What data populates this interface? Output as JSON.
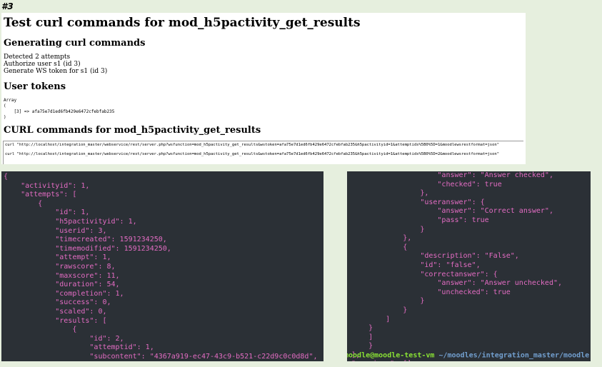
{
  "label": "#3",
  "page": {
    "title": "Test curl commands for mod_h5pactivity_get_results",
    "heading_generating": "Generating curl commands",
    "status_lines": [
      "Detected 2 attempts",
      "Authorize user s1 (id 3)",
      "Generate WS token for s1 (id 3)"
    ],
    "heading_tokens": "User tokens",
    "tokens_dump": "Array\n(\n    [3] => afa75e7d1ed6fb429e6472cfebfab235\n)",
    "heading_curl": "CURL commands for mod_h5pactivity_get_results",
    "curl_commands": [
      "curl \"http://localhost/integration_master/webservice/rest/server.php?wsfunction=mod_h5pactivity_get_results&wstoken=afa75e7d1ed6fb429e6472cfebfab235&h5pactivityid=1&attemptids%5B0%5D=1&moodlewsrestformat=json\"",
      "curl \"http://localhost/integration_master/webservice/rest/server.php?wsfunction=mod_h5pactivity_get_results&wstoken=afa75e7d1ed6fb429e6472cfebfab235&h5pactivityid=1&attemptids%5B0%5D=2&moodlewsrestformat=json\""
    ]
  },
  "terminal_left": {
    "output": "{\n    \"activityid\": 1,\n    \"attempts\": [\n        {\n            \"id\": 1,\n            \"h5pactivityid\": 1,\n            \"userid\": 3,\n            \"timecreated\": 1591234250,\n            \"timemodified\": 1591234250,\n            \"attempt\": 1,\n            \"rawscore\": 8,\n            \"maxscore\": 11,\n            \"duration\": 54,\n            \"completion\": 1,\n            \"success\": 0,\n            \"scaled\": 0,\n            \"results\": [\n                {\n                    \"id\": 2,\n                    \"attemptid\": 1,\n                    \"subcontent\": \"4367a919-ec47-43c9-b521-c22d9c0c0d8d\","
  },
  "terminal_right": {
    "output": "                    \"answer\": \"Answer checked\",\n                    \"checked\": true\n                },\n                \"useranswer\": {\n                    \"answer\": \"Correct answer\",\n                    \"pass\": true\n                }\n            },\n            {\n                \"description\": \"False\",\n                \"id\": \"false\",\n                \"correctanswer\": {\n                    \"answer\": \"Answer unchecked\",\n                    \"unchecked\": true\n                }\n            }\n        ]\n    }\n    ]\n    }\n],\n\"warnings\": []",
    "prompt_user": "moodle@moodle-test-vm",
    "prompt_path": " ~/moodles/integration_master/moodle",
    "prompt_symbol": " $"
  },
  "colors": {
    "terminal_bg": "#2b3036",
    "terminal_text": "#e36cc3",
    "page_bg": "#e6efde"
  }
}
